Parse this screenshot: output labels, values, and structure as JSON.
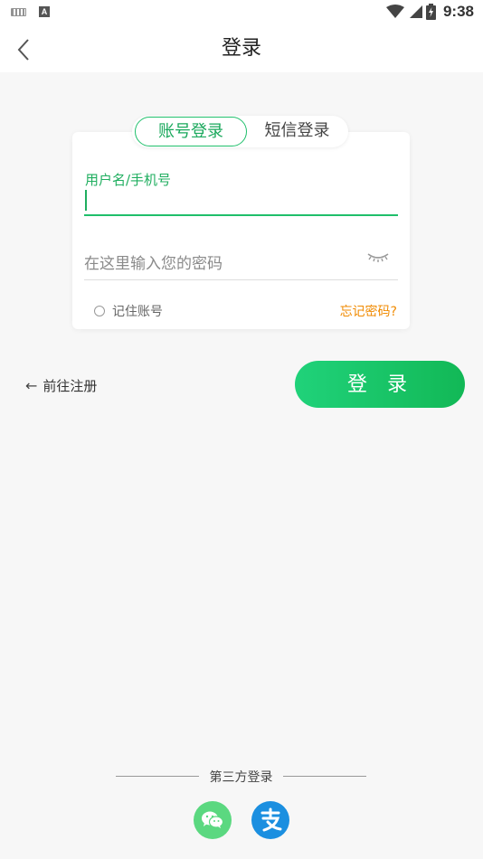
{
  "status_bar": {
    "time": "9:38",
    "a_badge": "A"
  },
  "header": {
    "title": "登录"
  },
  "tabs": {
    "account": "账号登录",
    "sms": "短信登录"
  },
  "form": {
    "username_label": "用户名/手机号",
    "username_value": "",
    "password_placeholder": "在这里输入您的密码",
    "remember_label": "记住账号",
    "forgot_label": "忘记密码?"
  },
  "actions": {
    "register_label": "前往注册",
    "register_arrow": "←",
    "login_label": "登录"
  },
  "third_party": {
    "label": "第三方登录",
    "providers": [
      "wechat",
      "alipay"
    ]
  },
  "colors": {
    "accent": "#1fbf6b",
    "warning": "#f08a00",
    "wechat": "#5bd880",
    "alipay": "#1b8fe0"
  }
}
